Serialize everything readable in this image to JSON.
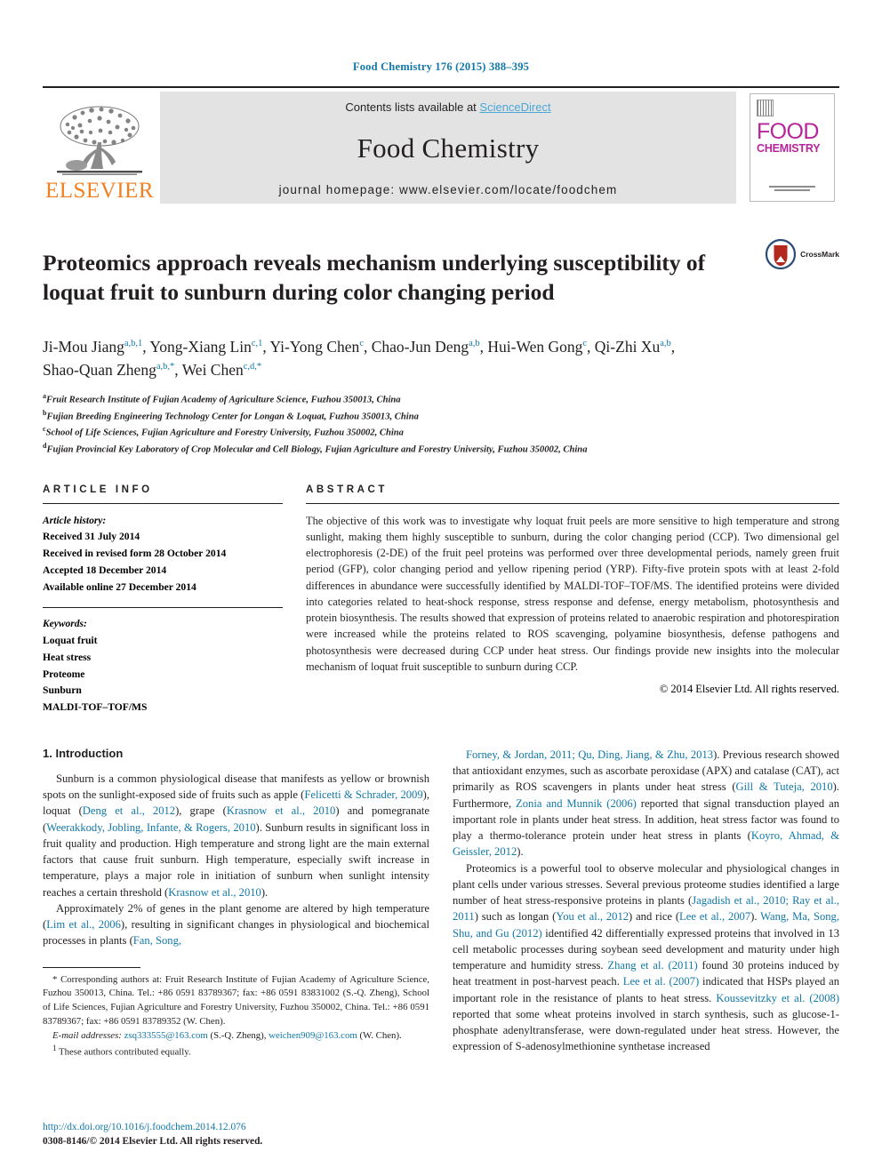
{
  "running_head": "Food Chemistry 176 (2015) 388–395",
  "banner": {
    "publisher": "ELSEVIER",
    "contents_prefix": "Contents lists available at ",
    "contents_link": "ScienceDirect",
    "journal_name": "Food Chemistry",
    "homepage": "journal homepage: www.elsevier.com/locate/foodchem",
    "cover_title_top": "FOOD",
    "cover_title_bottom": "CHEMISTRY"
  },
  "article": {
    "title": "Proteomics approach reveals mechanism underlying susceptibility of loquat fruit to sunburn during color changing period",
    "crossmark_label": "CrossMark",
    "authors_line1": "Ji-Mou Jiang a,b,1, Yong-Xiang Lin c,1, Yi-Yong Chen c, Chao-Jun Deng a,b, Hui-Wen Gong c, Qi-Zhi Xu a,b,",
    "authors_line2": "Shao-Quan Zheng a,b,*, Wei Chen c,d,*",
    "authors": [
      {
        "name": "Ji-Mou Jiang",
        "sup": "a,b,1"
      },
      {
        "name": "Yong-Xiang Lin",
        "sup": "c,1"
      },
      {
        "name": "Yi-Yong Chen",
        "sup": "c"
      },
      {
        "name": "Chao-Jun Deng",
        "sup": "a,b"
      },
      {
        "name": "Hui-Wen Gong",
        "sup": "c"
      },
      {
        "name": "Qi-Zhi Xu",
        "sup": "a,b"
      },
      {
        "name": "Shao-Quan Zheng",
        "sup": "a,b,*"
      },
      {
        "name": "Wei Chen",
        "sup": "c,d,*"
      }
    ],
    "affiliations": [
      {
        "mark": "a",
        "text": "Fruit Research Institute of Fujian Academy of Agriculture Science, Fuzhou 350013, China"
      },
      {
        "mark": "b",
        "text": "Fujian Breeding Engineering Technology Center for Longan & Loquat, Fuzhou 350013, China"
      },
      {
        "mark": "c",
        "text": "School of Life Sciences, Fujian Agriculture and Forestry University, Fuzhou 350002, China"
      },
      {
        "mark": "d",
        "text": "Fujian Provincial Key Laboratory of Crop Molecular and Cell Biology, Fujian Agriculture and Forestry University, Fuzhou 350002, China"
      }
    ]
  },
  "article_info": {
    "heading": "ARTICLE INFO",
    "history_label": "Article history:",
    "history": [
      "Received 31 July 2014",
      "Received in revised form 28 October 2014",
      "Accepted 18 December 2014",
      "Available online 27 December 2014"
    ],
    "keywords_label": "Keywords:",
    "keywords": [
      "Loquat fruit",
      "Heat stress",
      "Proteome",
      "Sunburn",
      "MALDI-TOF–TOF/MS"
    ]
  },
  "abstract": {
    "heading": "ABSTRACT",
    "text": "The objective of this work was to investigate why loquat fruit peels are more sensitive to high temperature and strong sunlight, making them highly susceptible to sunburn, during the color changing period (CCP). Two dimensional gel electrophoresis (2-DE) of the fruit peel proteins was performed over three developmental periods, namely green fruit period (GFP), color changing period and yellow ripening period (YRP). Fifty-five protein spots with at least 2-fold differences in abundance were successfully identified by MALDI-TOF–TOF/MS. The identified proteins were divided into categories related to heat-shock response, stress response and defense, energy metabolism, photosynthesis and protein biosynthesis. The results showed that expression of proteins related to anaerobic respiration and photorespiration were increased while the proteins related to ROS scavenging, polyamine biosynthesis, defense pathogens and photosynthesis were decreased during CCP under heat stress. Our findings provide new insights into the molecular mechanism of loquat fruit susceptible to sunburn during CCP.",
    "copyright": "© 2014 Elsevier Ltd. All rights reserved."
  },
  "introduction": {
    "heading": "1. Introduction",
    "left_paragraphs": [
      {
        "runs": [
          {
            "t": "Sunburn is a common physiological disease that manifests as yellow or brownish spots on the sunlight-exposed side of fruits such as apple ("
          },
          {
            "t": "Felicetti & Schrader, 2009",
            "ref": true
          },
          {
            "t": "), loquat ("
          },
          {
            "t": "Deng et al., 2012",
            "ref": true
          },
          {
            "t": "), grape ("
          },
          {
            "t": "Krasnow et al., 2010",
            "ref": true
          },
          {
            "t": ") and pomegranate ("
          },
          {
            "t": "Weerakkody, Jobling, Infante, & Rogers, 2010",
            "ref": true
          },
          {
            "t": "). Sunburn results in significant loss in fruit quality and production. High temperature and strong light are the main external factors that cause fruit sunburn. High temperature, especially swift increase in temperature, plays a major role in initiation of sunburn when sunlight intensity reaches a certain threshold ("
          },
          {
            "t": "Krasnow et al., 2010",
            "ref": true
          },
          {
            "t": ")."
          }
        ]
      },
      {
        "runs": [
          {
            "t": "Approximately 2% of genes in the plant genome are altered by high temperature ("
          },
          {
            "t": "Lim et al., 2006",
            "ref": true
          },
          {
            "t": "), resulting in significant changes in physiological and biochemical processes in plants ("
          },
          {
            "t": "Fan, Song,",
            "ref": true
          }
        ]
      }
    ],
    "right_paragraphs": [
      {
        "runs": [
          {
            "t": "Forney, & Jordan, 2011; Qu, Ding, Jiang, & Zhu, 2013",
            "ref": true
          },
          {
            "t": "). Previous research showed that antioxidant enzymes, such as ascorbate peroxidase (APX) and catalase (CAT), act primarily as ROS scavengers in plants under heat stress ("
          },
          {
            "t": "Gill & Tuteja, 2010",
            "ref": true
          },
          {
            "t": "). Furthermore, "
          },
          {
            "t": "Zonia and Munnik (2006)",
            "ref": true
          },
          {
            "t": " reported that signal transduction played an important role in plants under heat stress. In addition, heat stress factor was found to play a thermo-tolerance protein under heat stress in plants ("
          },
          {
            "t": "Koyro, Ahmad, & Geissler, 2012",
            "ref": true
          },
          {
            "t": ")."
          }
        ]
      },
      {
        "runs": [
          {
            "t": "Proteomics is a powerful tool to observe molecular and physiological changes in plant cells under various stresses. Several previous proteome studies identified a large number of heat stress-responsive proteins in plants ("
          },
          {
            "t": "Jagadish et al., 2010; Ray et al., 2011",
            "ref": true
          },
          {
            "t": ") such as longan ("
          },
          {
            "t": "You et al., 2012",
            "ref": true
          },
          {
            "t": ") and rice ("
          },
          {
            "t": "Lee et al., 2007",
            "ref": true
          },
          {
            "t": "). "
          },
          {
            "t": "Wang, Ma, Song, Shu, and Gu (2012)",
            "ref": true
          },
          {
            "t": " identified 42 differentially expressed proteins that involved in 13 cell metabolic processes during soybean seed development and maturity under high temperature and humidity stress. "
          },
          {
            "t": "Zhang et al. (2011)",
            "ref": true
          },
          {
            "t": " found 30 proteins induced by heat treatment in post-harvest peach. "
          },
          {
            "t": "Lee et al. (2007)",
            "ref": true
          },
          {
            "t": " indicated that HSPs played an important role in the resistance of plants to heat stress. "
          },
          {
            "t": "Koussevitzky et al. (2008)",
            "ref": true
          },
          {
            "t": " reported that some wheat proteins involved in starch synthesis, such as glucose-1-phosphate adenyltransferase, were down-regulated under heat stress. However, the expression of S-adenosylmethionine synthetase increased"
          }
        ]
      }
    ]
  },
  "footnotes": {
    "corresponding": "* Corresponding authors at: Fruit Research Institute of Fujian Academy of Agriculture Science, Fuzhou 350013, China. Tel.: +86 0591 83789367; fax: +86 0591 83831002 (S.-Q. Zheng), School of Life Sciences, Fujian Agriculture and Forestry University, Fuzhou 350002, China. Tel.: +86 0591 83789367; fax: +86 0591 83789352 (W. Chen).",
    "email_label": "E-mail addresses:",
    "email1": "zsq333555@163.com",
    "email1_owner": "(S.-Q. Zheng),",
    "email2": "weichen909@163.com",
    "email2_owner": "(W. Chen).",
    "equal_contrib_mark": "1",
    "equal_contrib": "These authors contributed equally."
  },
  "footer": {
    "doi": "http://dx.doi.org/10.1016/j.foodchem.2014.12.076",
    "issn": "0308-8146/© 2014 Elsevier Ltd. All rights reserved."
  },
  "colors": {
    "link_blue": "#1178a8",
    "sciencedirect_blue": "#4aa7d8",
    "elsevier_orange": "#f08122",
    "cover_magenta": "#b6259a",
    "crossmark_red": "#b5281f"
  }
}
